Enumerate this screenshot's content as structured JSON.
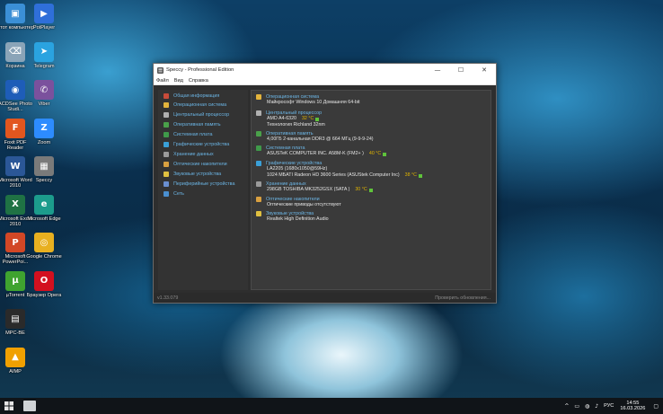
{
  "desktop": {
    "icons": [
      {
        "label": "Этот компьютер",
        "color": "#3b8fd6",
        "glyph": "▣"
      },
      {
        "label": "PotPlayer",
        "color": "#2f6fd9",
        "glyph": "▶"
      },
      {
        "label": "Корзина",
        "color": "#8aa4b8",
        "glyph": "⌫"
      },
      {
        "label": "Telegram",
        "color": "#2aa3e0",
        "glyph": "➤"
      },
      {
        "label": "ACDSee Photo Studi...",
        "color": "#1e5db8",
        "glyph": "◉"
      },
      {
        "label": "Viber",
        "color": "#7b519d",
        "glyph": "✆"
      },
      {
        "label": "Foxit PDF Reader",
        "color": "#e2561f",
        "glyph": "F"
      },
      {
        "label": "Zoom",
        "color": "#2d8cff",
        "glyph": "Z"
      },
      {
        "label": "Microsoft Word 2010",
        "color": "#2b5797",
        "glyph": "W"
      },
      {
        "label": "Speccy",
        "color": "#7a7a7a",
        "glyph": "▦"
      },
      {
        "label": "Microsoft Excel 2010",
        "color": "#1f7244",
        "glyph": "X"
      },
      {
        "label": "Microsoft Edge",
        "color": "#1c9c8c",
        "glyph": "e"
      },
      {
        "label": "Microsoft PowerPoi...",
        "color": "#d24726",
        "glyph": "P"
      },
      {
        "label": "Google Chrome",
        "color": "#e8b020",
        "glyph": "◎"
      },
      {
        "label": "µTorrent",
        "color": "#3fa32f",
        "glyph": "µ"
      },
      {
        "label": "Браузер Opera",
        "color": "#d3101f",
        "glyph": "O"
      },
      {
        "label": "MPC-BE",
        "color": "#2a2a2a",
        "glyph": "▤"
      },
      {
        "label": "",
        "color": "transparent",
        "glyph": ""
      },
      {
        "label": "AIMP",
        "color": "#f0a000",
        "glyph": "▲"
      }
    ]
  },
  "window": {
    "title": "Speccy - Professional Edition",
    "controls": {
      "minimize": "—",
      "maximize": "☐",
      "close": "✕"
    },
    "menu": [
      "Файл",
      "Вид",
      "Справка"
    ],
    "sidebar": [
      {
        "label": "Общая информация",
        "color": "#c94b3a"
      },
      {
        "label": "Операционная система",
        "color": "#e3b43c"
      },
      {
        "label": "Центральный процессор",
        "color": "#b0b0b0"
      },
      {
        "label": "Оперативная память",
        "color": "#4aa14a"
      },
      {
        "label": "Системная плата",
        "color": "#3f9a4a"
      },
      {
        "label": "Графические устройства",
        "color": "#3aa0d8"
      },
      {
        "label": "Хранение данных",
        "color": "#9a9a9a"
      },
      {
        "label": "Оптические накопители",
        "color": "#d9a040"
      },
      {
        "label": "Звуковые устройства",
        "color": "#e0c040"
      },
      {
        "label": "Периферийные устройства",
        "color": "#6a8fd0"
      },
      {
        "label": "Сеть",
        "color": "#4a8fd0"
      }
    ],
    "sections": [
      {
        "heading": "Операционная система",
        "color": "#e3b43c",
        "lines": [
          {
            "text": "Майкрософт Windows 10 Домашняя 64-bit",
            "temp": ""
          }
        ]
      },
      {
        "heading": "Центральный процессор",
        "color": "#b0b0b0",
        "lines": [
          {
            "text": "AMD A4-6320",
            "temp": "32 °C"
          },
          {
            "text": "Технология Richland 32nm",
            "temp": ""
          }
        ]
      },
      {
        "heading": "Оперативная память",
        "color": "#4aa14a",
        "lines": [
          {
            "text": "4,00ГБ 2-канальная DDR3 @ 664 МГц (9-9-9-24)",
            "temp": ""
          }
        ]
      },
      {
        "heading": "Системная плата",
        "color": "#3f9a4a",
        "lines": [
          {
            "text": "ASUSTeK COMPUTER INC. A58M-K (FM2+ )",
            "temp": "40 °C"
          }
        ]
      },
      {
        "heading": "Графические устройства",
        "color": "#3aa0d8",
        "lines": [
          {
            "text": "LA2205 (1680x1050@59Hz)",
            "temp": ""
          },
          {
            "text": "1024 МБATI Radeon HD 3600 Series (ASUStek Computer Inc)",
            "temp": "38 °C"
          }
        ]
      },
      {
        "heading": "Хранение данных",
        "color": "#9a9a9a",
        "lines": [
          {
            "text": "298GB TOSHIBA MK3252GSX (SATA )",
            "temp": "30 °C"
          }
        ]
      },
      {
        "heading": "Оптические накопители",
        "color": "#d9a040",
        "lines": [
          {
            "text": "Оптические приводы отсутствуют",
            "temp": ""
          }
        ]
      },
      {
        "heading": "Звуковые устройства",
        "color": "#e0c040",
        "lines": [
          {
            "text": "Realtek High Definition Audio",
            "temp": ""
          }
        ]
      }
    ],
    "status": {
      "version": "v1.33.079",
      "update": "Проверить обновления..."
    }
  },
  "taskbar": {
    "tray_icons": [
      "^",
      "▭",
      "◍",
      "♪"
    ],
    "language": "РУС",
    "time": "14:55",
    "date": "16.03.2026",
    "notify": "▢"
  }
}
